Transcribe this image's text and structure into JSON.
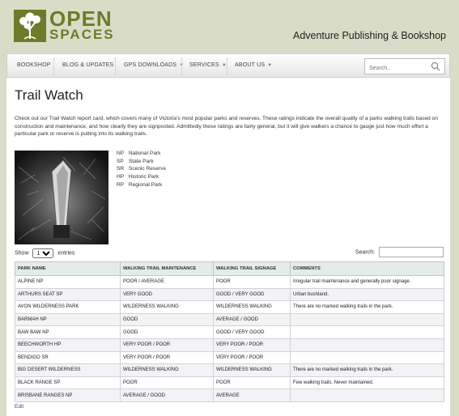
{
  "brand": {
    "word1": "OPEN",
    "word2": "SPACES",
    "tagline": "Adventure Publishing & Bookshop"
  },
  "nav": {
    "items": [
      {
        "label": "BOOKSHOP",
        "dropdown": false
      },
      {
        "label": "BLOG & UPDATES",
        "dropdown": false
      },
      {
        "label": "GPS DOWNLOADS",
        "dropdown": true
      },
      {
        "label": "SERVICES",
        "dropdown": true
      },
      {
        "label": "ABOUT US",
        "dropdown": true
      }
    ],
    "search_placeholder": "Search.."
  },
  "page": {
    "title": "Trail Watch",
    "intro": "Check out our Trail Watch report card, which covers many of Victoria's most popular parks and reserves. These ratings indicate the overall quality of a parks walking trails based on construction and maintenance, and how clearly they are signposted. Admittedly these ratings are fairly general, but it will give walkers a chance to gauge just how much effort a particular park or reserve is putting into its walking trails."
  },
  "legend": [
    {
      "abbr": "NP",
      "name": "National Park"
    },
    {
      "abbr": "SP",
      "name": "State Park"
    },
    {
      "abbr": "SR",
      "name": "Scenic Reserve"
    },
    {
      "abbr": "HP",
      "name": "Historic Park"
    },
    {
      "abbr": "RP",
      "name": "Regional Park"
    }
  ],
  "table_controls": {
    "show_label": "Show",
    "entries_value": "10",
    "entries_label": "entries",
    "search_label": "Search:"
  },
  "table": {
    "headers": [
      "PARK NAME",
      "WALKING TRAIL MAINTENANCE",
      "WALKING TRAIL SIGNAGE",
      "COMMENTS"
    ],
    "rows": [
      [
        "ALPINE NP",
        "POOR / AVERAGE",
        "POOR",
        "Irregular trail maintenance and generally poor signage."
      ],
      [
        "ARTHURS SEAT SP",
        "VERY GOOD",
        "GOOD / VERY GOOD",
        "Urban bushland."
      ],
      [
        "AVON WILDERNESS PARK",
        "WILDERNESS WALKING",
        "WILDERNESS WALKING",
        "There are no marked walking trails in the park."
      ],
      [
        "BARMAH NP",
        "GOOD",
        "AVERAGE / GOOD",
        ""
      ],
      [
        "BAW BAW NP",
        "GOOD",
        "GOOD / VERY GOOD",
        ""
      ],
      [
        "BEECHWORTH HP",
        "VERY POOR / POOR",
        "VERY POOR / POOR",
        ""
      ],
      [
        "BENDIGO SR",
        "VERY POOR / POOR",
        "VERY POOR / POOR",
        ""
      ],
      [
        "BIG DESERT WILDERNESS",
        "WILDERNESS WALKING",
        "WILDERNESS WALKING",
        "There are no marked walking trails in the park."
      ],
      [
        "BLACK RANGE SP",
        "POOR",
        "POOR",
        "Few walking trails. Never maintained."
      ],
      [
        "BRISBANE RANGES NP",
        "AVERAGE / GOOD",
        "AVERAGE",
        ""
      ]
    ]
  },
  "footer": {
    "edit_label": "Edit"
  },
  "colors": {
    "brand_olive": "#6f7a2a",
    "page_bg": "#d9ddc7",
    "header_row_bg": "#e3ece6"
  }
}
